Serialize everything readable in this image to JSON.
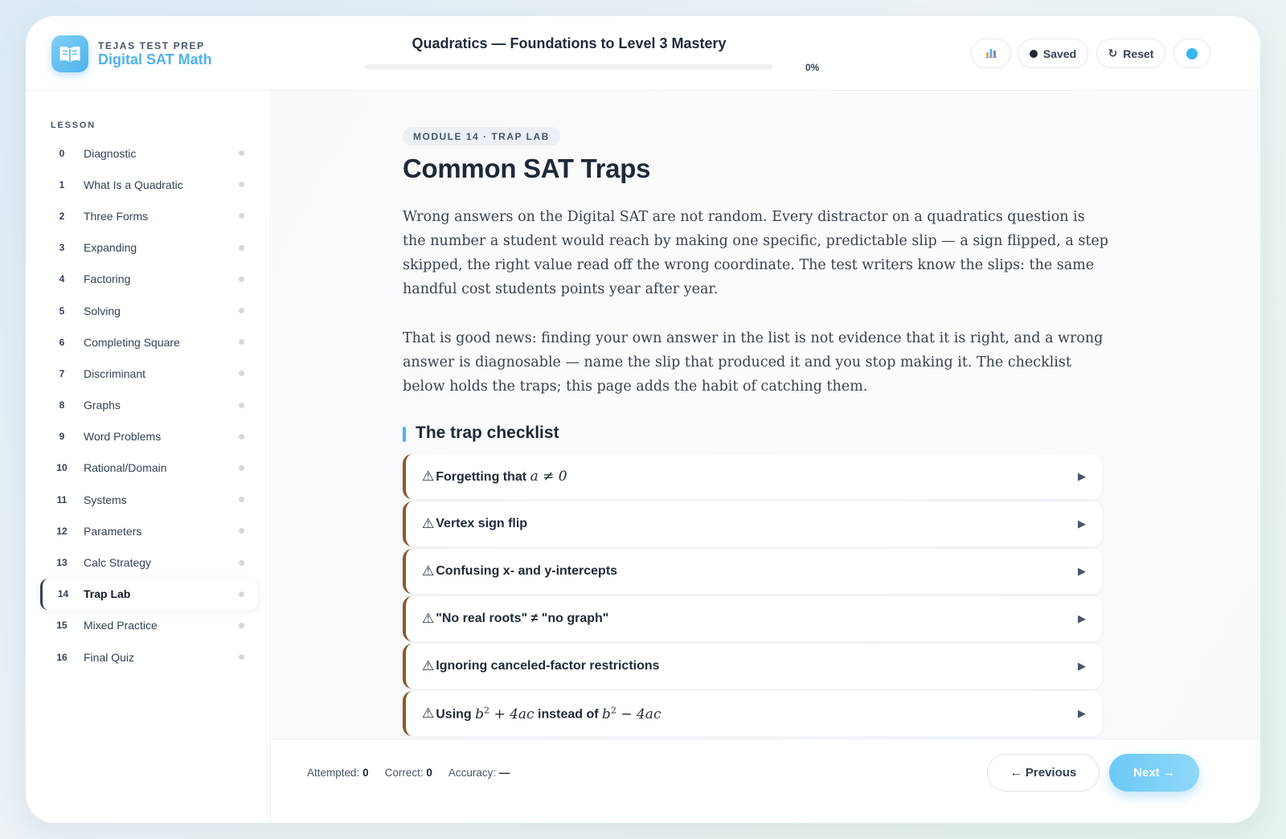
{
  "brand": {
    "top": "TEJAS TEST PREP",
    "main": "Digital SAT Math",
    "logo_icon": "open-book-icon"
  },
  "header": {
    "course_title": "Quadratics — Foundations to Level 3 Mastery",
    "progress_fraction": 0,
    "progress_label": "0%",
    "stats_icon": "bar-chart-icon",
    "saved_label": "Saved",
    "reset_label": "Reset",
    "reset_icon": "↻",
    "accent_color": "#4fb2ec"
  },
  "sidebar": {
    "heading": "LESSON",
    "items": [
      {
        "num": "0",
        "label": "Diagnostic"
      },
      {
        "num": "1",
        "label": "What Is a Quadratic"
      },
      {
        "num": "2",
        "label": "Three Forms"
      },
      {
        "num": "3",
        "label": "Expanding"
      },
      {
        "num": "4",
        "label": "Factoring"
      },
      {
        "num": "5",
        "label": "Solving"
      },
      {
        "num": "6",
        "label": "Completing Square"
      },
      {
        "num": "7",
        "label": "Discriminant"
      },
      {
        "num": "8",
        "label": "Graphs"
      },
      {
        "num": "9",
        "label": "Word Problems"
      },
      {
        "num": "10",
        "label": "Rational/Domain"
      },
      {
        "num": "11",
        "label": "Systems"
      },
      {
        "num": "12",
        "label": "Parameters"
      },
      {
        "num": "13",
        "label": "Calc Strategy"
      },
      {
        "num": "14",
        "label": "Trap Lab"
      },
      {
        "num": "15",
        "label": "Mixed Practice"
      },
      {
        "num": "16",
        "label": "Final Quiz"
      }
    ],
    "active_index": 14
  },
  "main": {
    "module_pill": "MODULE 14 · TRAP LAB",
    "title": "Common SAT Traps",
    "paragraph1": "Wrong answers on the Digital SAT are not random. Every distractor on a quadratics question is the number a student would reach by making one specific, predictable slip — a sign flipped, a step skipped, the right value read off the wrong coordinate. The test writers know the slips: the same handful cost students points year after year.",
    "paragraph2": "That is good news: finding your own answer in the list is not evidence that it is right, and a wrong answer is diagnosable — name the slip that produced it and you stop making it. The checklist below holds the traps; this page adds the habit of catching them.",
    "checklist_heading": "The trap checklist",
    "warning_glyph": "⚠",
    "expand_glyph": "▶",
    "traps": [
      {
        "label": "Forgetting that",
        "math": "a ≠ 0"
      },
      {
        "label": "Vertex sign flip"
      },
      {
        "label": "Confusing x- and y-intercepts"
      },
      {
        "label": "\"No real roots\" ≠ \"no graph\""
      },
      {
        "label": "Ignoring canceled-factor restrictions"
      },
      {
        "label": "Using",
        "math1_base": "b",
        "math1_exp": "2",
        "math1_rest": " + 4ac",
        "mid": "instead of",
        "math2_base": "b",
        "math2_exp": "2",
        "math2_rest": " − 4ac"
      }
    ],
    "trap_border_color": "#8b5a2b"
  },
  "footer": {
    "attempted_label": "Attempted:",
    "attempted_value": "0",
    "correct_label": "Correct:",
    "correct_value": "0",
    "accuracy_label": "Accuracy:",
    "accuracy_value": "—",
    "prev_label": "← Previous",
    "next_label": "Next →"
  }
}
